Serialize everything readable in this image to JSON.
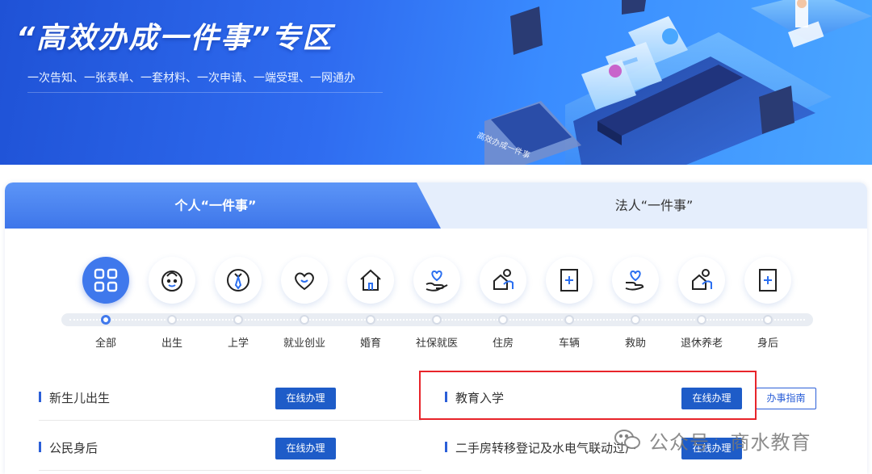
{
  "banner": {
    "title": "“高效办成一件事”专区",
    "subtitle": "一次告知、一张表单、一套材料、一次申请、一端受理、一网通办",
    "illustration_label": "高效办成一件事"
  },
  "tabs": [
    {
      "label": "个人“一件事”",
      "active": true
    },
    {
      "label": "法人“一件事”",
      "active": false
    }
  ],
  "categories": [
    {
      "label": "全部",
      "icon": "grid-icon",
      "active": true
    },
    {
      "label": "出生",
      "icon": "baby-icon"
    },
    {
      "label": "上学",
      "icon": "school-tie-icon"
    },
    {
      "label": "就业创业",
      "icon": "heart-hands-icon"
    },
    {
      "label": "婚育",
      "icon": "home-icon"
    },
    {
      "label": "社保就医",
      "icon": "care-hand-icon"
    },
    {
      "label": "住房",
      "icon": "house-person-icon"
    },
    {
      "label": "车辆",
      "icon": "plus-document-icon"
    },
    {
      "label": "救助",
      "icon": "heart-hand-icon"
    },
    {
      "label": "退休养老",
      "icon": "elder-person-icon"
    },
    {
      "label": "身后",
      "icon": "plus-document-icon"
    }
  ],
  "services": {
    "left": [
      {
        "name": "新生儿出生",
        "button": "在线办理"
      },
      {
        "name": "公民身后",
        "button": "在线办理"
      }
    ],
    "right": [
      {
        "name": "教育入学",
        "button": "在线办理",
        "guide": "办事指南",
        "highlighted": true
      },
      {
        "name": "二手房转移登记及水电气联动过户",
        "button": "在线办理"
      }
    ]
  },
  "watermark": {
    "prefix": "公众号",
    "separator": "·",
    "name": "商水教育"
  },
  "colors": {
    "primary": "#1e5cc8",
    "tab_active": "#3e76ea",
    "highlight": "#e8242a"
  }
}
